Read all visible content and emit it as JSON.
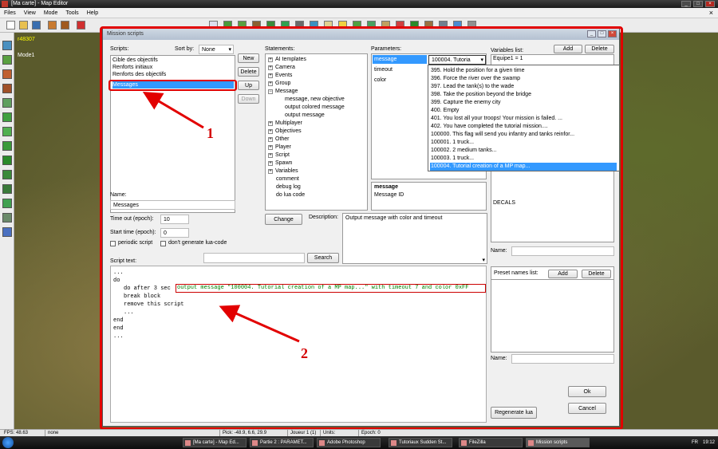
{
  "app": {
    "title": "[Ma carte] - Map Editor",
    "menu": [
      "Files",
      "View",
      "Mode",
      "Tools",
      "Help"
    ],
    "map_coord": "r48307",
    "map_mode": "Mode1"
  },
  "statusbar": {
    "fps": "FPS: 48.63",
    "mode": "none",
    "pick": "Pick: -48.9, 6.6, 29.9",
    "player": "Joueur 1 (1)",
    "units": "Units:",
    "epoch": "Epoch: 0"
  },
  "taskbar": {
    "items": [
      "[Ma carte] - Map Ed...",
      "Partie 2 : PARAMET...",
      "Adobe Photoshop",
      "Tutoriaux Sudden St...",
      "FileZilla",
      "Mission scripts"
    ],
    "lang": "FR",
    "clock": "19:12"
  },
  "dialog": {
    "title": "Mission scripts",
    "scripts_label": "Scripts:",
    "sortby_label": "Sort by:",
    "sortby_value": "None",
    "scripts": [
      "Cible des objectifs",
      "Renforts initiaux",
      "Renforts des objectifs",
      "Messages"
    ],
    "buttons": {
      "new": "New",
      "delete": "Delete",
      "up": "Up",
      "down": "Down",
      "change": "Change",
      "search": "Search",
      "ok": "Ok",
      "cancel": "Cancel",
      "regenerate": "Regenerate lua",
      "add": "Add"
    },
    "name_label": "Name:",
    "name_value": "Messages",
    "timeout_label": "Time out (epoch):",
    "timeout_value": "10",
    "starttime_label": "Start time (epoch):",
    "starttime_value": "0",
    "periodic_label": "periodic script",
    "nolua_label": "don't generate lua-code",
    "scripttext_label": "Script text:",
    "statements_label": "Statements:",
    "statements": [
      {
        "label": "AI templates",
        "depth": 0,
        "expand": true
      },
      {
        "label": "Camera",
        "depth": 0,
        "expand": true
      },
      {
        "label": "Events",
        "depth": 0,
        "expand": true
      },
      {
        "label": "Group",
        "depth": 0,
        "expand": true
      },
      {
        "label": "Message",
        "depth": 0,
        "expand": true
      },
      {
        "label": "message, new objective",
        "depth": 1,
        "expand": false
      },
      {
        "label": "output colored message",
        "depth": 1,
        "expand": false
      },
      {
        "label": "output message",
        "depth": 1,
        "expand": false
      },
      {
        "label": "Multiplayer",
        "depth": 0,
        "expand": true
      },
      {
        "label": "Objectives",
        "depth": 0,
        "expand": true
      },
      {
        "label": "Other",
        "depth": 0,
        "expand": true
      },
      {
        "label": "Player",
        "depth": 0,
        "expand": true
      },
      {
        "label": "Script",
        "depth": 0,
        "expand": true
      },
      {
        "label": "Spawn",
        "depth": 0,
        "expand": true
      },
      {
        "label": "Variables",
        "depth": 0,
        "expand": true
      },
      {
        "label": "comment",
        "depth": 0,
        "expand": false
      },
      {
        "label": "debug log",
        "depth": 0,
        "expand": false
      },
      {
        "label": "do lua code",
        "depth": 0,
        "expand": false
      }
    ],
    "description_label": "Description:",
    "description_text": "Output message with color and timeout",
    "parameters_label": "Parameters:",
    "parameters": [
      "message",
      "timeout",
      "color"
    ],
    "param_value": "100004. Tutoria",
    "param_info_title": "message",
    "param_info_text": "Message ID",
    "dropdown_items": [
      "395. Hold the position for a given time",
      "396. Force the river over the swamp",
      "397. Lead the tank(s) to the wade",
      "398. Take the position beyond the bridge",
      "399. Capture the enemy city",
      "400. Empty",
      "401. You lost all your troops! Your mission is failed. ...",
      "402. You have completed the tutorial mission....",
      "100000. This flag will send you infantry and tanks reinfor...",
      "100001. 1 truck...",
      "100002. 2 medium tanks...",
      "100003. 1 truck...",
      "100004. Tutorial creation of a MP map..."
    ],
    "variables_label": "Variables list:",
    "variables_first": "Equipe1 = 1",
    "decals": "DECALS",
    "preset_label": "Preset names list:",
    "code": {
      "l1": "...",
      "l2": "do",
      "l3": "do after 3 sec",
      "l3_hl": "output message \"100004. Tutorial creation of a MP map...\" with timeout 7 and color 0xFF",
      "l4": "break block",
      "l5": "remove this script",
      "l6": "...",
      "l7": "end",
      "l8": "end",
      "l9": "..."
    }
  },
  "annotations": {
    "n1": "1",
    "n2": "2"
  },
  "colors": {
    "accent": "#e20000",
    "selection": "#3399ff",
    "code_green": "#008000"
  }
}
